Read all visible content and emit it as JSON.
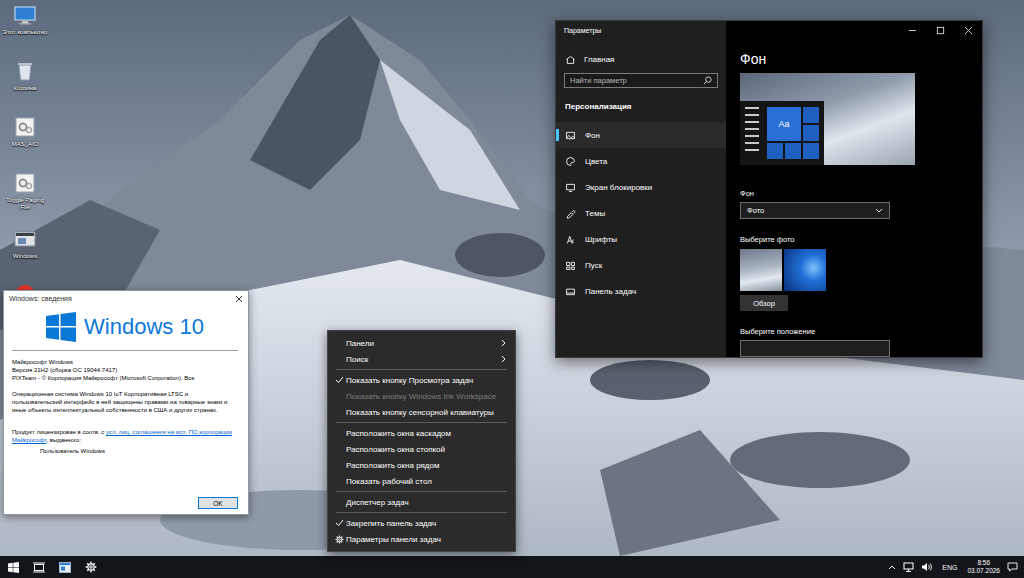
{
  "desktop": {
    "icons": [
      {
        "kind": "computer",
        "label": "Этот компьютер"
      },
      {
        "kind": "bin",
        "label": "Корзина"
      },
      {
        "kind": "tool",
        "label": "MAS_AIO"
      },
      {
        "kind": "tool",
        "label": "Toggle Paging File"
      },
      {
        "kind": "app",
        "label": "Windows"
      },
      {
        "kind": "browser"
      }
    ]
  },
  "about_window": {
    "title": "Windows: сведения",
    "logo_text": "Windows 10",
    "lines": [
      "Майкрософт Windows",
      "Версия 21H2 (сборка ОС 19044.7417)",
      "PIXTeam - © Корпорация Майкрософт (Microsoft Corporation). Все"
    ],
    "description": "Операционная система Windows 10 IoT Корпоративная LTSC и пользовательский интерфейс в ней защищены правами на товарные знаки и иные объекты интеллектуальной собственности в США и других странах.",
    "license": {
      "before": "Продукт лицензирован в соотв. с ",
      "link": "усл. лиц. соглашения на исп. ПО корпорации Майкрософт",
      "after": ", выданного:"
    },
    "licensee": "Пользователь Windows",
    "buttons": [
      "OK"
    ]
  },
  "settings_window": {
    "title": "Параметры",
    "home": "Главная",
    "search": {
      "placeholder": "Найти параметр"
    },
    "section": "Персонализация",
    "nav": [
      {
        "label": "Фон",
        "selected": true
      },
      {
        "label": "Цвета",
        "selected": false
      },
      {
        "label": "Экран блокировки",
        "selected": false
      },
      {
        "label": "Темы",
        "selected": false
      },
      {
        "label": "Шрифты",
        "selected": false
      },
      {
        "label": "Пуск",
        "selected": false
      },
      {
        "label": "Панель задач",
        "selected": false
      }
    ],
    "page_title": "Фон",
    "preview": {
      "sample": "Aa"
    },
    "background": {
      "label": "Фон",
      "value": "Фото"
    },
    "photos": {
      "label": "Выберите фото",
      "items": [
        {
          "kind": "mountain"
        },
        {
          "kind": "windows"
        }
      ],
      "browse": "Обзор"
    },
    "position": {
      "label": "Выберите положение"
    }
  },
  "context_menu": {
    "items": [
      {
        "kind": "item",
        "label": "Панели",
        "submenu": true,
        "checked": false,
        "disabled": false
      },
      {
        "kind": "item",
        "label": "Поиск",
        "submenu": true,
        "checked": false,
        "disabled": false
      },
      {
        "kind": "separator"
      },
      {
        "kind": "item",
        "label": "Показать кнопку Просмотра задач",
        "submenu": false,
        "checked": true,
        "disabled": false
      },
      {
        "kind": "item",
        "label": "Показать кнопку Windows Ink Workspace",
        "submenu": false,
        "checked": false,
        "disabled": true
      },
      {
        "kind": "item",
        "label": "Показать кнопку сенсорной клавиатуры",
        "submenu": false,
        "checked": false,
        "disabled": false
      },
      {
        "kind": "separator"
      },
      {
        "kind": "item",
        "label": "Расположить окна каскадом",
        "submenu": false,
        "checked": false,
        "disabled": false
      },
      {
        "kind": "item",
        "label": "Расположить окна стопкой",
        "submenu": false,
        "checked": false,
        "disabled": false
      },
      {
        "kind": "item",
        "label": "Расположить окна рядом",
        "submenu": false,
        "checked": false,
        "disabled": false
      },
      {
        "kind": "item",
        "label": "Показать рабочий стол",
        "submenu": false,
        "checked": false,
        "disabled": false
      },
      {
        "kind": "separator"
      },
      {
        "kind": "item",
        "label": "Диспетчер задач",
        "submenu": false,
        "checked": false,
        "disabled": false
      },
      {
        "kind": "separator"
      },
      {
        "kind": "item",
        "label": "Закрепить панель задач",
        "submenu": false,
        "checked": true,
        "disabled": false
      },
      {
        "kind": "settings",
        "label": "Параметры панели задач",
        "submenu": false,
        "checked": false,
        "disabled": false
      }
    ]
  },
  "taskbar": {
    "language": "ENG",
    "time": "8:56",
    "date": "03.07.2026"
  }
}
